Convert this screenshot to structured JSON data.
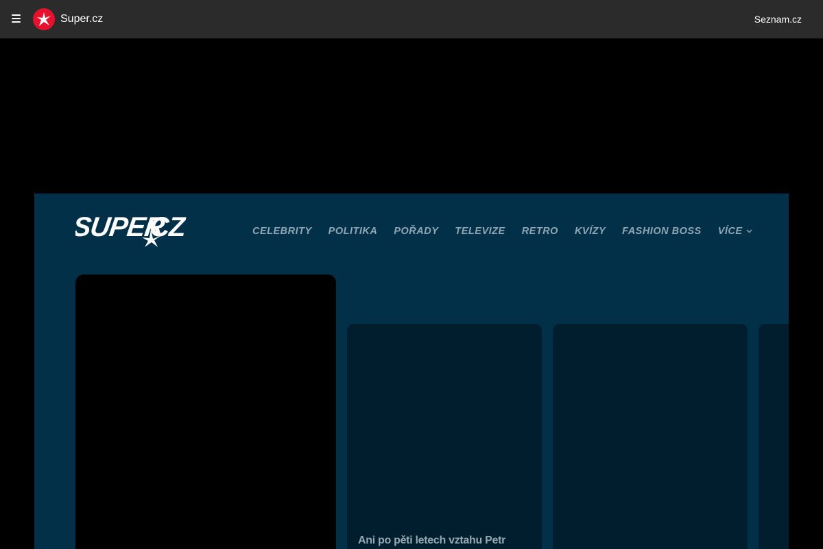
{
  "topbar": {
    "brand_name": "Super.cz",
    "seznam_label": "Seznam.cz",
    "menu_icon": "hamburger-icon",
    "brand_icon": "super-star-icon"
  },
  "site": {
    "logo_text": "SUPER.CZ",
    "nav": [
      {
        "label": "CELEBRITY"
      },
      {
        "label": "POLITIKA"
      },
      {
        "label": "POŘADY"
      },
      {
        "label": "TELEVIZE"
      },
      {
        "label": "RETRO"
      },
      {
        "label": "KVÍZY"
      },
      {
        "label": "FASHION BOSS"
      },
      {
        "label": "VÍCE"
      }
    ],
    "cards": [
      {
        "title": "Ani po pěti letech vztahu Petr"
      },
      {
        "title": ""
      },
      {
        "title": ""
      }
    ]
  },
  "colors": {
    "topbar_bg": "#2b2b2b",
    "site_bg": "#023048",
    "card_bg": "#001e2d",
    "brand_red": "#e8112d",
    "nav_text": "#8fa7b5"
  }
}
